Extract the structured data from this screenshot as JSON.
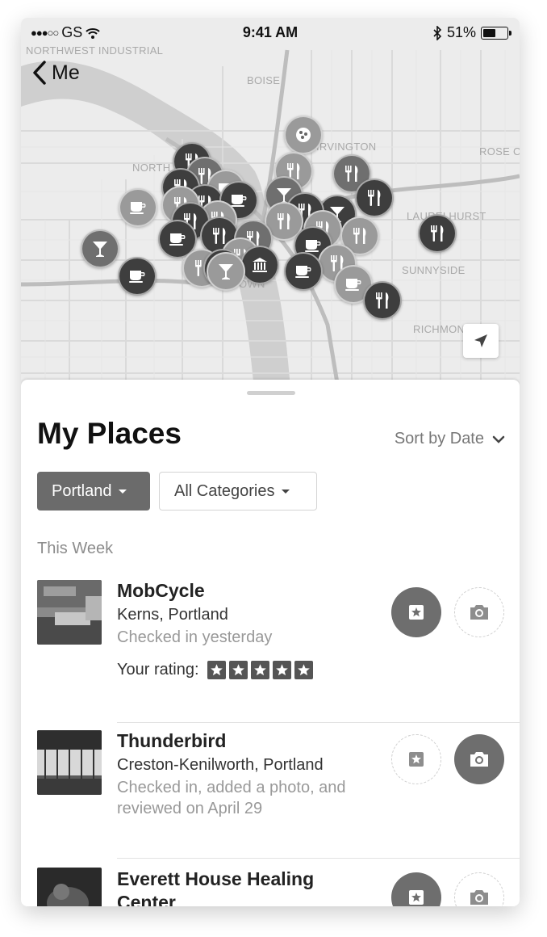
{
  "status_bar": {
    "carrier": "GS",
    "time": "9:41 AM",
    "battery": "51%"
  },
  "nav": {
    "back_label": "Me"
  },
  "map": {
    "labels": {
      "northwest_industrial": "NORTHWEST INDUSTRIAL",
      "boise": "BOISE",
      "irvington": "IRVINGTON",
      "rose_city": "ROSE CI",
      "north_district": "NORTH DISTR",
      "laurelhurst": "LAURELHURST",
      "sunnyside": "SUNNYSIDE",
      "richmond": "RICHMON",
      "town": "TOWN"
    },
    "pin_categories": [
      "restaurant",
      "coffee",
      "bar",
      "museum",
      "attraction"
    ]
  },
  "sheet": {
    "title": "My Places",
    "sort_label": "Sort by Date",
    "filters": {
      "city": "Portland",
      "category": "All Categories"
    },
    "section_header": "This Week",
    "places": [
      {
        "name": "MobCycle",
        "neighborhood": "Kerns, Portland",
        "activity": "Checked in yesterday",
        "rating_label": "Your rating:",
        "rating": 5
      },
      {
        "name": "Thunderbird",
        "neighborhood": "Creston-Kenilworth, Portland",
        "activity": "Checked in, added a photo, and reviewed on April 29"
      },
      {
        "name": "Everett House Healing Center"
      }
    ]
  }
}
